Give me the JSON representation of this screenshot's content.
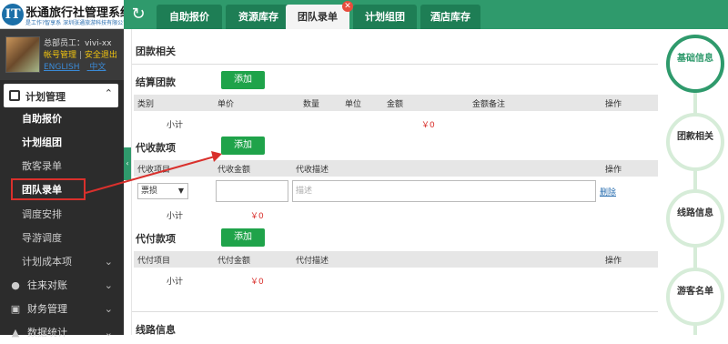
{
  "header": {
    "logo_letter": "IT",
    "title": "张通旅行社管理系统",
    "subtitle": "是工作?智享系 深圳张通旅游科技有限公司"
  },
  "tabs": [
    {
      "label": "自助报价"
    },
    {
      "label": "资源库存"
    },
    {
      "label": "团队录单"
    },
    {
      "label": "计划组团"
    },
    {
      "label": "酒店库存"
    }
  ],
  "profile": {
    "name": "总部员工：vivi-xx",
    "account_link": "帐号管理",
    "sep": "|",
    "logout_link": "安全退出",
    "lang_en": "ENGLISH",
    "lang_zh": "中文"
  },
  "sidebar": {
    "section_label": "计划管理",
    "items": [
      {
        "label": "自助报价"
      },
      {
        "label": "计划组团"
      },
      {
        "label": "散客录单"
      },
      {
        "label": "团队录单"
      },
      {
        "label": "调度安排"
      },
      {
        "label": "导游调度"
      },
      {
        "label": "计划成本项"
      }
    ],
    "groups": [
      {
        "label": "往来对账",
        "icon": "coins-icon"
      },
      {
        "label": "财务管理",
        "icon": "wallet-icon"
      },
      {
        "label": "数据统计",
        "icon": "chart-icon"
      }
    ]
  },
  "main": {
    "section_title": "团款相关",
    "settle": {
      "title": "结算团款",
      "add_label": "添加",
      "headers": [
        "类别",
        "单价",
        "数量",
        "单位",
        "金额",
        "金额备注",
        "操作"
      ],
      "subtotal_label": "小计",
      "subtotal_value": "￥0"
    },
    "collect": {
      "title": "代收款项",
      "add_label": "添加",
      "headers": [
        "代收项目",
        "代收金额",
        "代收描述",
        "操作"
      ],
      "row_select": "票损",
      "row_desc_placeholder": "描述",
      "row_delete": "删除",
      "subtotal_label": "小计",
      "subtotal_value": "￥0"
    },
    "pay": {
      "title": "代付款项",
      "add_label": "添加",
      "headers": [
        "代付项目",
        "代付金额",
        "代付描述",
        "操作"
      ],
      "subtotal_label": "小计",
      "subtotal_value": "￥0"
    },
    "next_section": "线路信息"
  },
  "steps": [
    {
      "label": "基础信息",
      "active": true
    },
    {
      "label": "团款相关",
      "active": false
    },
    {
      "label": "线路信息",
      "active": false
    },
    {
      "label": "游客名单",
      "active": false
    }
  ],
  "colors": {
    "brand_green": "#2f9a6c",
    "add_button": "#1fa34a",
    "annotation_red": "#d9302c"
  }
}
